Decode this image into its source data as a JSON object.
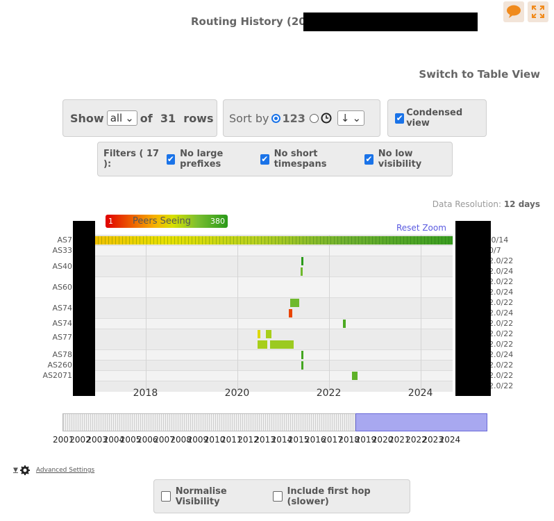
{
  "header": {
    "title": "Routing History (20",
    "comment_icon": "speech-bubble-icon",
    "fullscreen_icon": "expand-icon"
  },
  "view_switch": {
    "label": "Switch to Table View"
  },
  "show": {
    "prefix": "Show",
    "value": "all",
    "of_label": "of",
    "count": "31",
    "rows_label": "rows"
  },
  "sort": {
    "label": "Sort by",
    "option_number": "123",
    "option_number_selected": true,
    "option_time_selected": false,
    "direction": "↓"
  },
  "condensed": {
    "label": "Condensed view",
    "checked": true
  },
  "filters": {
    "label": "Filters ( 17 ):",
    "items": [
      {
        "label": "No large prefixes",
        "checked": true
      },
      {
        "label": "No short timespans",
        "checked": true
      },
      {
        "label": "No low visibility",
        "checked": true
      }
    ]
  },
  "resolution": {
    "label": "Data Resolution:",
    "value": "12 days"
  },
  "legend": {
    "min": "1",
    "title": "Peers Seeing",
    "max": "380",
    "color_low": "#e00000",
    "color_high": "#2a9a1a"
  },
  "reset_zoom": "Reset Zoom",
  "chart_data": {
    "type": "heatmap",
    "y_labels_left": [
      "AS7",
      "AS33",
      "AS40",
      "AS60",
      "AS74",
      "AS74",
      "AS77",
      "AS78",
      "AS260",
      "AS2071"
    ],
    "y_labels_right": [
      ".0/14",
      "0/7",
      "2.0/22",
      "2.0/24",
      "2.0/22",
      "2.0/24",
      "2.0/22",
      "2.0/24",
      "2.0/22",
      "2.0/22",
      "2.0/22",
      "2.0/24",
      "2.0/22",
      "2.0/22",
      "2.0/22"
    ],
    "x_ticks": [
      "2018",
      "2020",
      "2022",
      "2024"
    ],
    "xlim": [
      2016.9,
      2024.7
    ],
    "color_scale": {
      "min": 1,
      "max": 380,
      "title": "Peers Seeing"
    },
    "segments": [
      {
        "row": 0,
        "start": 2016.9,
        "end": 2024.7,
        "peers": 300
      },
      {
        "row": 2,
        "start": 2021.4,
        "end": 2021.45,
        "peers": 380
      },
      {
        "row": 3,
        "start": 2021.38,
        "end": 2021.42,
        "peers": 300
      },
      {
        "row": 6,
        "start": 2021.15,
        "end": 2021.35,
        "peers": 300
      },
      {
        "row": 7,
        "start": 2021.12,
        "end": 2021.2,
        "peers": 60
      },
      {
        "row": 8,
        "start": 2022.3,
        "end": 2022.37,
        "peers": 340
      },
      {
        "row": 9,
        "start": 2020.45,
        "end": 2020.5,
        "peers": 200
      },
      {
        "row": 9,
        "start": 2020.62,
        "end": 2020.75,
        "peers": 250
      },
      {
        "row": 10,
        "start": 2020.45,
        "end": 2020.65,
        "peers": 250
      },
      {
        "row": 10,
        "start": 2020.72,
        "end": 2021.23,
        "peers": 260
      },
      {
        "row": 11,
        "start": 2021.4,
        "end": 2021.45,
        "peers": 350
      },
      {
        "row": 12,
        "start": 2021.4,
        "end": 2021.45,
        "peers": 350
      },
      {
        "row": 13,
        "start": 2022.5,
        "end": 2022.62,
        "peers": 320
      }
    ]
  },
  "navigator": {
    "years": [
      "2001",
      "2002",
      "2003",
      "2004",
      "2005",
      "2006",
      "2007",
      "2008",
      "2009",
      "2010",
      "2011",
      "2012",
      "2013",
      "2014",
      "2015",
      "2016",
      "2017",
      "2018",
      "2019",
      "2020",
      "2021",
      "2022",
      "2023",
      "2024"
    ],
    "selected_from": "2017",
    "selected_to": "2024"
  },
  "advanced": {
    "label": "Advanced Settings",
    "icon": "gear-icon"
  },
  "options": [
    {
      "label": "Normalise Visibility",
      "checked": false
    },
    {
      "label": "Include first hop (slower)",
      "checked": false
    }
  ]
}
